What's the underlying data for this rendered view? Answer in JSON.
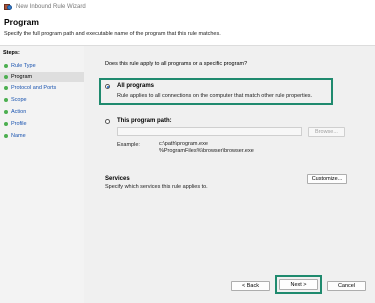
{
  "window": {
    "title": "New Inbound Rule Wizard"
  },
  "header": {
    "title": "Program",
    "description": "Specify the full program path and executable name of the program that this rule matches."
  },
  "sidebar": {
    "steps_label": "Steps:",
    "items": [
      {
        "label": "Rule Type"
      },
      {
        "label": "Program"
      },
      {
        "label": "Protocol and Ports"
      },
      {
        "label": "Scope"
      },
      {
        "label": "Action"
      },
      {
        "label": "Profile"
      },
      {
        "label": "Name"
      }
    ],
    "current": "Program"
  },
  "content": {
    "question": "Does this rule apply to all programs or a specific program?",
    "all_programs": {
      "label": "All programs",
      "description": "Rule applies to all connections on the computer that match other rule properties.",
      "checked": true
    },
    "this_program": {
      "label": "This program path:",
      "checked": false,
      "path_value": "",
      "browse_label": "Browse..."
    },
    "example": {
      "label": "Example:",
      "line1": "c:\\path\\program.exe",
      "line2": "%ProgramFiles%\\browser\\browser.exe"
    },
    "services": {
      "title": "Services",
      "description": "Specify which services this rule applies to.",
      "customize_label": "Customize..."
    }
  },
  "footer": {
    "back_label": "< Back",
    "next_label": "Next >",
    "cancel_label": "Cancel"
  },
  "colors": {
    "highlight": "#1f8a6e",
    "link": "#1b55b0",
    "step_dot": "#4caf50"
  }
}
